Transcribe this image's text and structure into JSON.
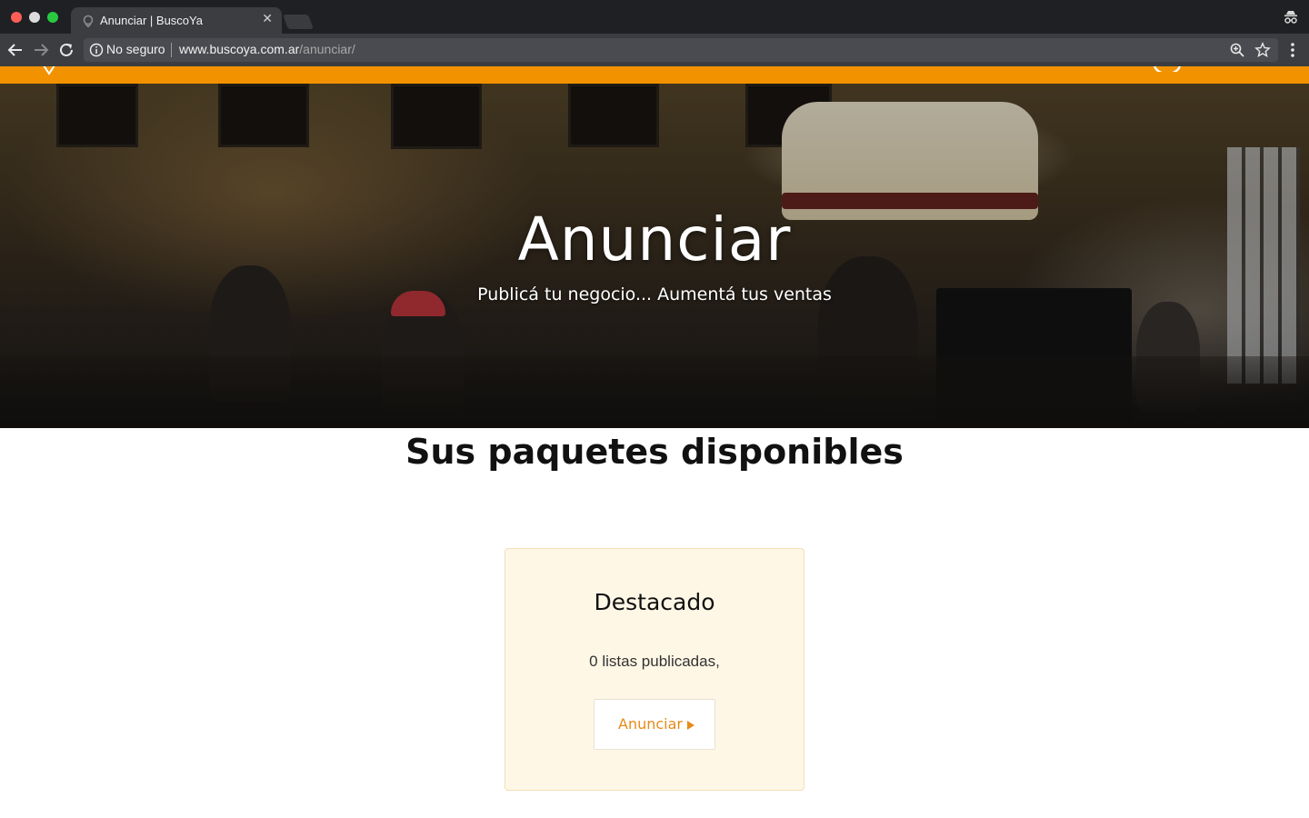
{
  "browser": {
    "tab_title": "Anunciar | BuscoYa",
    "security_label": "No seguro",
    "url_host": "www.buscoya.com.ar",
    "url_path": "/anunciar/",
    "icons": [
      "back-icon",
      "forward-icon",
      "reload-icon",
      "info-icon",
      "zoom-icon",
      "star-icon",
      "menu-icon",
      "incognito-icon",
      "tab-favicon",
      "tab-close-icon"
    ]
  },
  "site": {
    "brand_color": "#f39200"
  },
  "hero": {
    "title": "Anunciar",
    "subtitle": "Publicá tu negocio... Aumentá tus ventas"
  },
  "packages": {
    "section_title": "Sus paquetes disponibles",
    "items": [
      {
        "name": "Destacado",
        "listings": "0 listas publicadas,",
        "button_label": "Anunciar",
        "card_color": "#fff7e6",
        "button_text_color": "#e88a1a"
      }
    ]
  }
}
